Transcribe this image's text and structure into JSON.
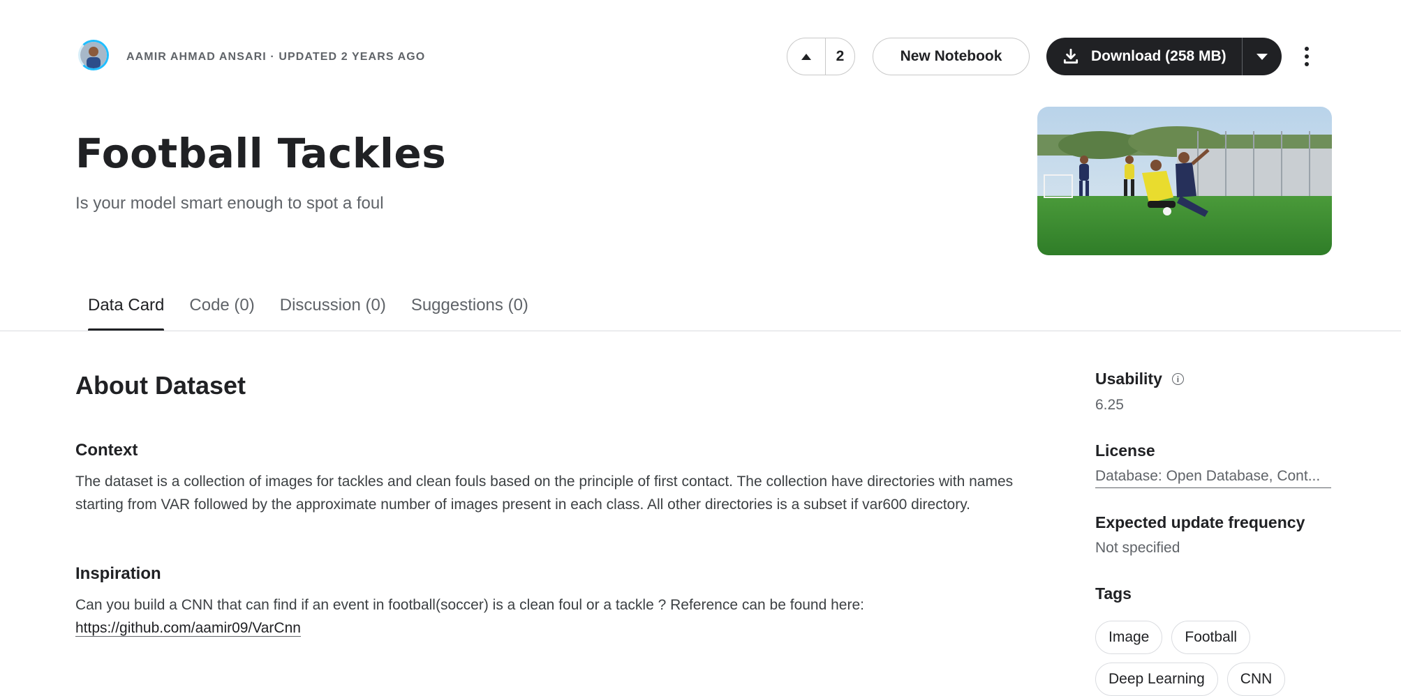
{
  "header": {
    "owner_line": "AAMIR AHMAD ANSARI · UPDATED 2 YEARS AGO",
    "vote_count": "2",
    "new_notebook_label": "New Notebook",
    "download_label": "Download (258 MB)"
  },
  "dataset": {
    "title": "Football Tackles",
    "subtitle": "Is your model smart enough to spot a foul"
  },
  "tabs": [
    {
      "label": "Data Card",
      "active": true
    },
    {
      "label": "Code (0)",
      "active": false
    },
    {
      "label": "Discussion (0)",
      "active": false
    },
    {
      "label": "Suggestions (0)",
      "active": false
    }
  ],
  "main": {
    "heading": "About Dataset",
    "context_heading": "Context",
    "context_text": "The dataset is a collection of images for tackles and clean fouls based on the principle of first contact. The collection have directories with names starting from VAR followed by the approximate number of images present in each class. All other directories is a subset if var600 directory.",
    "inspiration_heading": "Inspiration",
    "inspiration_text": "Can you build a CNN that can find if an event in football(soccer) is a clean foul or a tackle ? Reference can be found here:",
    "inspiration_link": "https://github.com/aamir09/VarCnn"
  },
  "sidebar": {
    "usability_label": "Usability",
    "usability_value": "6.25",
    "license_label": "License",
    "license_value": "Database: Open Database, Cont...",
    "frequency_label": "Expected update frequency",
    "frequency_value": "Not specified",
    "tags_label": "Tags",
    "tags": [
      "Image",
      "Football",
      "Deep Learning",
      "CNN"
    ]
  },
  "icons": {
    "vote": "caret-up-icon",
    "download": "download-icon",
    "dropdown": "caret-down-icon",
    "more": "more-vert-icon",
    "info": "info-icon"
  },
  "colors": {
    "primary_button": "#202124",
    "avatar_ring": "#20beff",
    "text_secondary": "#5f6368"
  }
}
